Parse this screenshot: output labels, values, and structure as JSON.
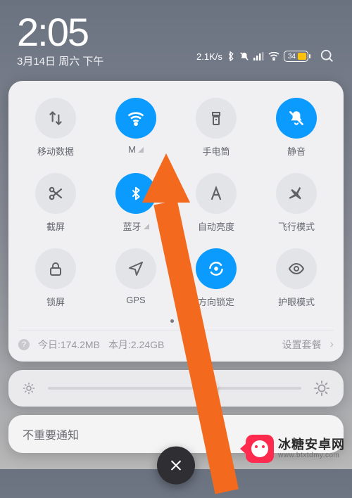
{
  "status": {
    "time": "2:05",
    "date": "3月14日 周六 下午",
    "net_speed": "2.1K/s",
    "battery_pct": "34"
  },
  "toggles": [
    {
      "id": "mobile-data",
      "label": "移动数据",
      "active": false,
      "signal": false,
      "icon": "arrows-updown"
    },
    {
      "id": "wifi",
      "label": "M",
      "active": true,
      "signal": true,
      "icon": "wifi"
    },
    {
      "id": "flashlight",
      "label": "手电筒",
      "active": false,
      "signal": false,
      "icon": "flashlight"
    },
    {
      "id": "mute",
      "label": "静音",
      "active": true,
      "signal": false,
      "icon": "bell-off"
    },
    {
      "id": "screenshot",
      "label": "截屏",
      "active": false,
      "signal": false,
      "icon": "scissors"
    },
    {
      "id": "bluetooth",
      "label": "蓝牙",
      "active": true,
      "signal": true,
      "icon": "bluetooth"
    },
    {
      "id": "auto-brightness",
      "label": "自动亮度",
      "active": false,
      "signal": false,
      "icon": "letter-a"
    },
    {
      "id": "airplane",
      "label": "飞行模式",
      "active": false,
      "signal": false,
      "icon": "airplane"
    },
    {
      "id": "lock-screen",
      "label": "锁屏",
      "active": false,
      "signal": false,
      "icon": "lock"
    },
    {
      "id": "gps",
      "label": "GPS",
      "active": false,
      "signal": false,
      "icon": "location"
    },
    {
      "id": "rotation-lock",
      "label": "方向锁定",
      "active": true,
      "signal": false,
      "icon": "rotation-lock"
    },
    {
      "id": "eye-comfort",
      "label": "护眼模式",
      "active": false,
      "signal": false,
      "icon": "eye"
    }
  ],
  "data_usage": {
    "today_label": "今日:174.2MB",
    "month_label": "本月:2.24GB",
    "plan_label": "设置套餐"
  },
  "notif": {
    "title": "不重要通知"
  },
  "watermark": {
    "cn": "冰糖安卓网",
    "en": "www.btxtdmy.com"
  }
}
